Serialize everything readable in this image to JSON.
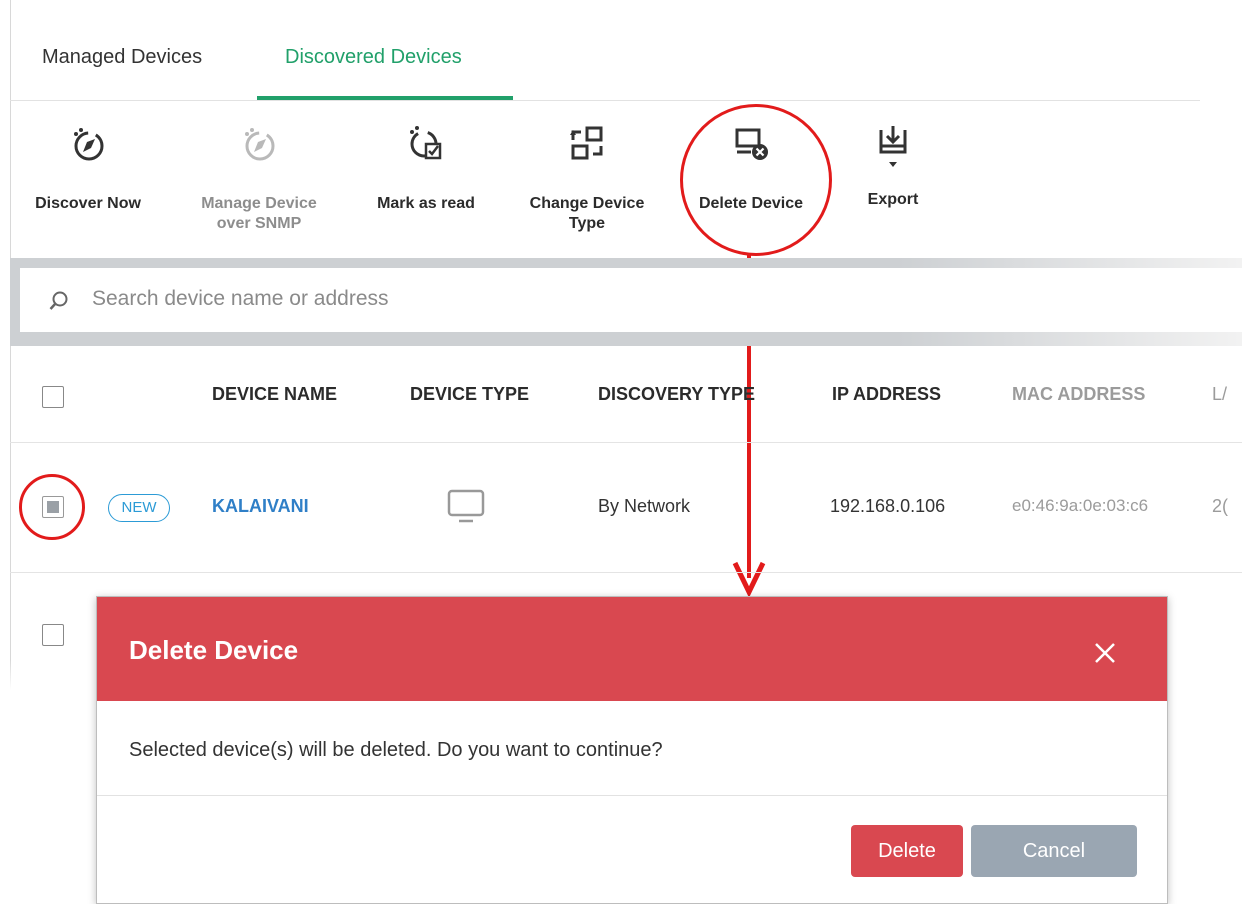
{
  "tabs": [
    {
      "label": "Managed Devices"
    },
    {
      "label": "Discovered Devices"
    }
  ],
  "toolbar": {
    "discover_now": "Discover Now",
    "manage_snmp_line1": "Manage Device",
    "manage_snmp_line2": "over SNMP",
    "mark_as_read": "Mark as read",
    "change_type_line1": "Change Device",
    "change_type_line2": "Type",
    "delete_device": "Delete Device",
    "export": "Export"
  },
  "search": {
    "placeholder": "Search device name or address"
  },
  "table": {
    "headers": {
      "device_name": "DEVICE NAME",
      "device_type": "DEVICE TYPE",
      "discovery_type": "DISCOVERY TYPE",
      "ip_address": "IP ADDRESS",
      "mac_address": "MAC ADDRESS",
      "cut_off": "L/"
    },
    "row1": {
      "badge": "NEW",
      "device_name": "KALAIVANI",
      "device_type_icon": "monitor-icon",
      "discovery_type": "By Network",
      "ip_address": "192.168.0.106",
      "mac_address": "e0:46:9a:0e:03:c6",
      "cut_off": "2("
    }
  },
  "modal": {
    "title": "Delete Device",
    "message": "Selected device(s) will be deleted. Do you want to continue?",
    "delete_label": "Delete",
    "cancel_label": "Cancel"
  },
  "colors": {
    "accent_green": "#21a06a",
    "modal_red": "#d94850",
    "annotation_red": "#e21b1b",
    "link_blue": "#2f7fc7",
    "cancel_gray": "#9aa6b2"
  }
}
